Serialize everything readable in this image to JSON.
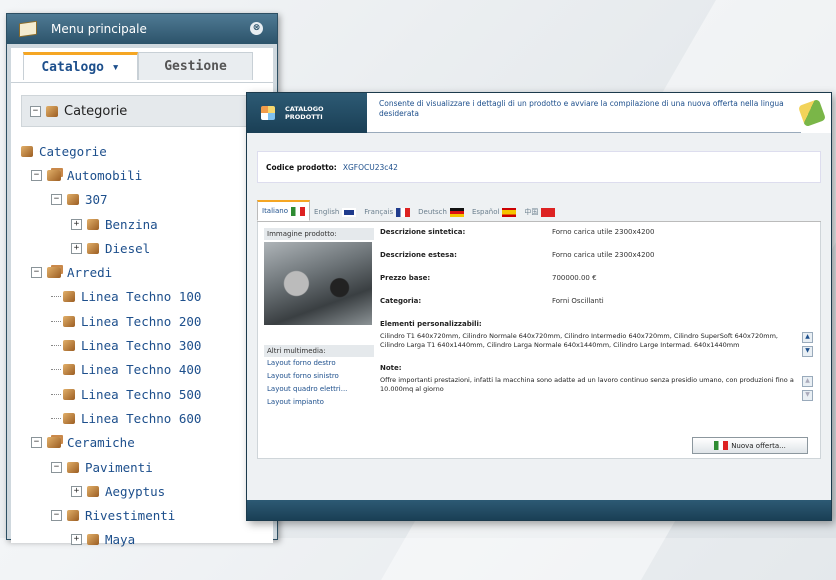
{
  "left_panel": {
    "title": "Menu principale",
    "close_symbol": "⊗",
    "tabs": [
      {
        "label": "Catalogo ▾",
        "active": true
      },
      {
        "label": "Gestione",
        "active": false
      }
    ],
    "root_label": "Categorie",
    "tree": [
      {
        "label": "Categorie",
        "level": 0
      },
      {
        "label": "Automobili",
        "level": 1
      },
      {
        "label": "307",
        "level": 2
      },
      {
        "label": "Benzina",
        "level": 3
      },
      {
        "label": "Diesel",
        "level": 3
      },
      {
        "label": "Arredi",
        "level": 1
      },
      {
        "label": "Linea Techno 100",
        "level": 2
      },
      {
        "label": "Linea Techno 200",
        "level": 2
      },
      {
        "label": "Linea Techno 300",
        "level": 2
      },
      {
        "label": "Linea Techno 400",
        "level": 2
      },
      {
        "label": "Linea Techno 500",
        "level": 2
      },
      {
        "label": "Linea Techno 600",
        "level": 2
      },
      {
        "label": "Ceramiche",
        "level": 1
      },
      {
        "label": "Pavimenti",
        "level": 2
      },
      {
        "label": "Aegyptus",
        "level": 3
      },
      {
        "label": "Rivestimenti",
        "level": 2
      },
      {
        "label": "Maya",
        "level": 3
      }
    ]
  },
  "window": {
    "badge_line1": "CATALOGO",
    "badge_line2": "PRODOTTI",
    "description": "Consente di visualizzare i dettagli di un prodotto e avviare la compilazione di una nuova offerta nella lingua desiderata",
    "code_label": "Codice prodotto:",
    "code_value": "XGFOCU23c42",
    "languages": [
      {
        "label": "Italiano",
        "flag": "it",
        "active": true
      },
      {
        "label": "English",
        "flag": "uk",
        "active": false
      },
      {
        "label": "Français",
        "flag": "fr",
        "active": false
      },
      {
        "label": "Deutsch",
        "flag": "de",
        "active": false
      },
      {
        "label": "Español",
        "flag": "es",
        "active": false
      },
      {
        "label": "中国",
        "flag": "cn",
        "active": false
      }
    ],
    "image_label": "Immagine prodotto:",
    "media_label": "Altri multimedia:",
    "media_links": [
      "Layout forno destro",
      "Layout forno sinistro",
      "Layout quadro elettri...",
      "Layout impianto"
    ],
    "fields": [
      {
        "label": "Descrizione sintetica:",
        "value": "Forno carica utile 2300x4200"
      },
      {
        "label": "Descrizione estesa:",
        "value": "Forno carica utile 2300x4200"
      },
      {
        "label": "Prezzo base:",
        "value": "700000.00 €"
      },
      {
        "label": "Categoria:",
        "value": "Forni Oscillanti"
      }
    ],
    "custom_title": "Elementi personalizzabili:",
    "custom_text": "Cilindro T1 640x720mm, Cilindro Normale 640x720mm, Cilindro Intermedio 640x720mm, Cilindro SuperSoft 640x720mm, Cilindro Larga T1 640x1440mm, Cilindro Larga Normale 640x1440mm, Cilindro Large Intermad. 640x1440mm",
    "notes_title": "Note:",
    "notes_text": "Offre importanti prestazioni, infatti la macchina sono adatte ad un lavoro continuo senza presidio umano, con produzioni fino a 10.000mq al giorno",
    "new_offer_label": "Nuova offerta..."
  }
}
